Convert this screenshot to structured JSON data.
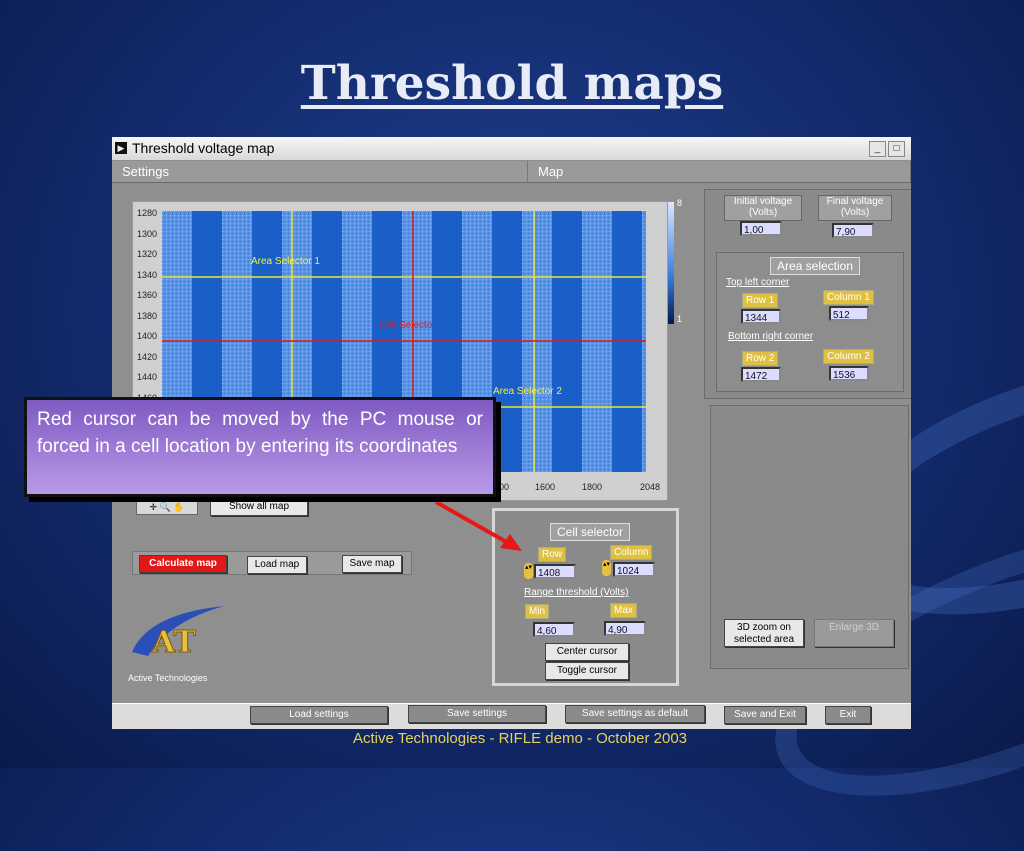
{
  "slide": {
    "title": "Threshold maps",
    "footer": "Active Technologies - RIFLE demo - October 2003",
    "callout": "Red cursor can be moved by the PC mouse or forced in a cell location by entering its coordinates"
  },
  "window": {
    "title": "Threshold voltage map",
    "tabs": [
      "Settings",
      "Map"
    ]
  },
  "plot": {
    "y_ticks": [
      "1280",
      "1300",
      "1320",
      "1340",
      "1360",
      "1380",
      "1400",
      "1420",
      "1440",
      "1460"
    ],
    "x_ticks": [
      "00",
      "1600",
      "1800",
      "2048"
    ],
    "scale_top": "8",
    "scale_bottom": "1",
    "area_selector_1": "Area Selector 1",
    "area_selector_2": "Area Selector 2",
    "cell_selector_label": "Cell Selector",
    "colors": {
      "cursor": "#e01818",
      "area": "#e8e830",
      "dark_band": "#1a5fc8",
      "light_band": "#4f8ae0"
    }
  },
  "left_buttons": {
    "show_all_map": "Show all map",
    "calculate_map": "Calculate map",
    "load_map": "Load map",
    "save_map": "Save map"
  },
  "logo": {
    "text": "AT",
    "caption": "Active Technologies"
  },
  "voltage": {
    "initial_label": "Initial voltage (Volts)",
    "initial_value": "1,00",
    "final_label": "Final voltage (Volts)",
    "final_value": "7,90"
  },
  "area_selection": {
    "title": "Area selection",
    "top_left": "Top left corner",
    "row1_label": "Row 1",
    "row1_value": "1344",
    "col1_label": "Column 1",
    "col1_value": "512",
    "bottom_right": "Bottom right corner",
    "row2_label": "Row 2",
    "row2_value": "1472",
    "col2_label": "Column 2",
    "col2_value": "1536"
  },
  "cell_selector": {
    "title": "Cell selector",
    "row_label": "Row",
    "row_value": "1408",
    "col_label": "Column",
    "col_value": "1024",
    "range_label": "Range threshold (Volts)",
    "min_label": "Min",
    "min_value": "4,60",
    "max_label": "Max",
    "max_value": "4,90",
    "center_cursor": "Center cursor",
    "toggle_cursor": "Toggle cursor"
  },
  "zoom": {
    "zoom3d": "3D zoom on selected area",
    "enlarge3d": "Enlarge 3D"
  },
  "bottom_bar": {
    "load_settings": "Load settings",
    "save_settings": "Save settings",
    "save_default": "Save settings as default",
    "save_exit": "Save and Exit",
    "exit": "Exit"
  }
}
